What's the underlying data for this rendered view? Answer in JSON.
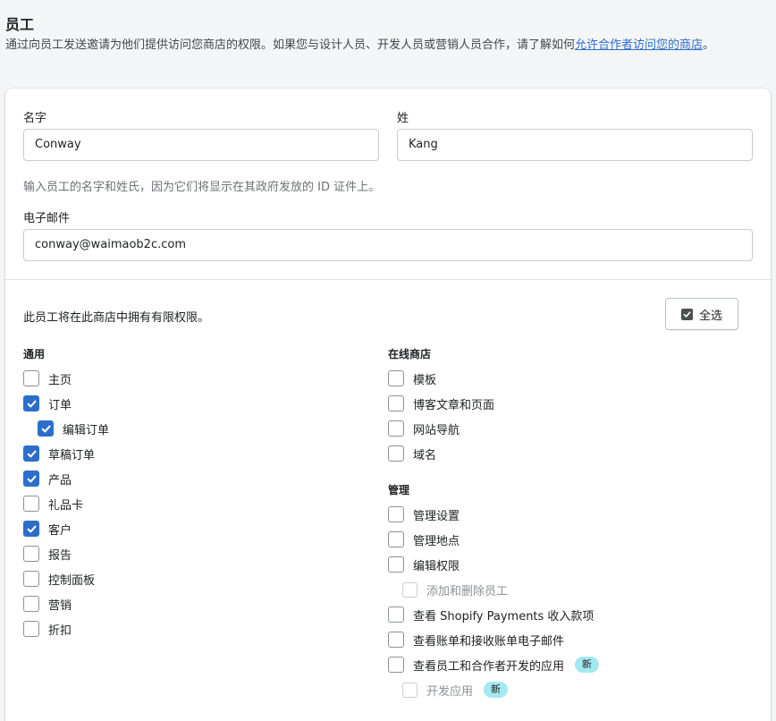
{
  "header": {
    "title": "员工",
    "desc_before": "通过向员工发送邀请为他们提供访问您商店的权限。如果您与设计人员、开发人员或营销人员合作，请了解如何",
    "desc_link": "允许合作者访问您的商店",
    "desc_after": "。"
  },
  "form": {
    "first_name_label": "名字",
    "first_name_value": "Conway",
    "last_name_label": "姓",
    "last_name_value": "Kang",
    "name_help": "输入员工的名字和姓氏，因为它们将显示在其政府发放的 ID 证件上。",
    "email_label": "电子邮件",
    "email_value": "conway@waimaob2c.com"
  },
  "permissions": {
    "note": "此员工将在此商店中拥有有限权限。",
    "select_all_label": "全选",
    "general": {
      "title": "通用",
      "items": [
        {
          "label": "主页",
          "checked": false
        },
        {
          "label": "订单",
          "checked": true
        },
        {
          "label": "编辑订单",
          "checked": true
        },
        {
          "label": "草稿订单",
          "checked": true
        },
        {
          "label": "产品",
          "checked": true
        },
        {
          "label": "礼品卡",
          "checked": false
        },
        {
          "label": "客户",
          "checked": true
        },
        {
          "label": "报告",
          "checked": false
        },
        {
          "label": "控制面板",
          "checked": false
        },
        {
          "label": "营销",
          "checked": false
        },
        {
          "label": "折扣",
          "checked": false
        }
      ]
    },
    "online_store": {
      "title": "在线商店",
      "items": [
        {
          "label": "模板",
          "checked": false
        },
        {
          "label": "博客文章和页面",
          "checked": false
        },
        {
          "label": "网站导航",
          "checked": false
        },
        {
          "label": "域名",
          "checked": false
        }
      ]
    },
    "admin": {
      "title": "管理",
      "items": [
        {
          "label": "管理设置",
          "checked": false
        },
        {
          "label": "管理地点",
          "checked": false
        },
        {
          "label": "编辑权限",
          "checked": false
        },
        {
          "label": "添加和删除员工",
          "checked": false,
          "disabled": true
        },
        {
          "label": "查看 Shopify Payments 收入款项",
          "checked": false
        },
        {
          "label": "查看账单和接收账单电子邮件",
          "checked": false
        },
        {
          "label": "查看员工和合作者开发的应用",
          "checked": false,
          "badge": "新"
        },
        {
          "label": "开发应用",
          "checked": false,
          "disabled": true,
          "badge": "新"
        }
      ]
    }
  },
  "colors": {
    "accent": "#2c6ecb",
    "badge_bg": "#a4e8f2"
  }
}
